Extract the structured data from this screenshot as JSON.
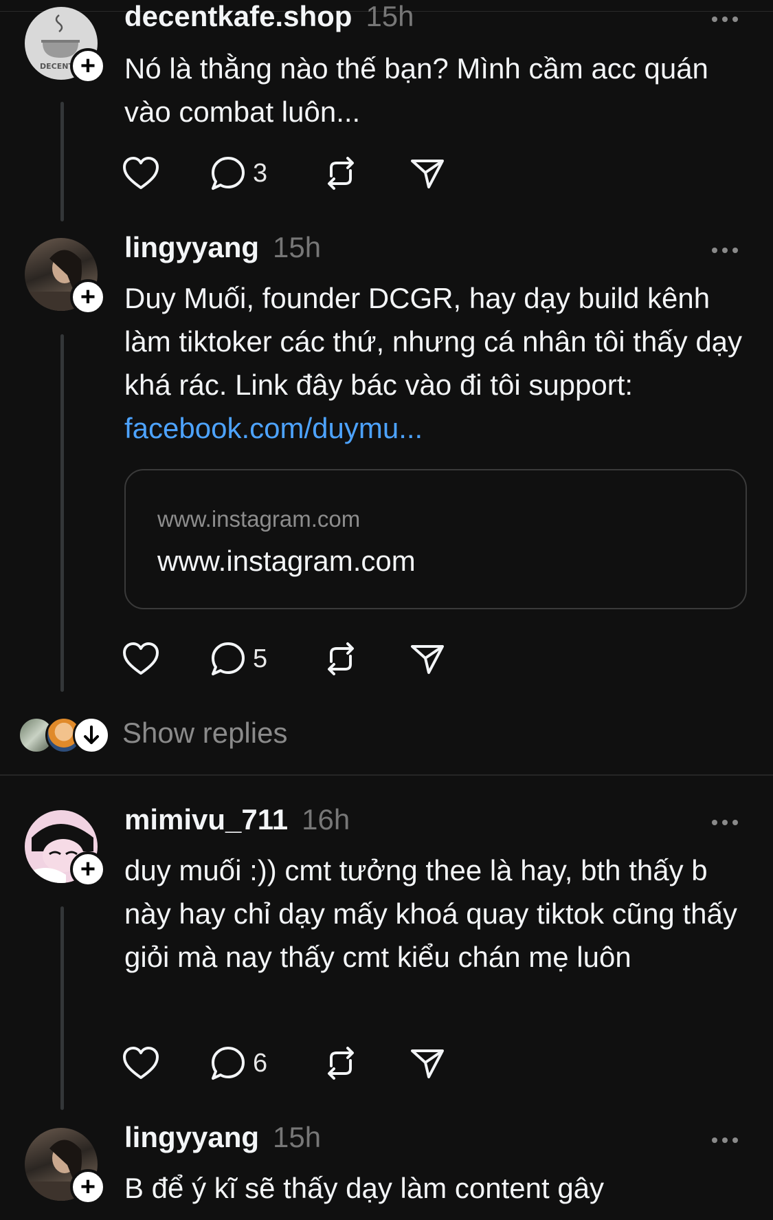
{
  "colors": {
    "background": "#101010",
    "text": "#f3f5f7",
    "muted": "#777777",
    "link": "#4da3ff",
    "thread_line": "#333638"
  },
  "posts": [
    {
      "username": "decentkafe.shop",
      "time": "15h",
      "avatar_text": "DECENT",
      "text": "Nó là thằng nào thế bạn? Mình cầm acc quán vào combat luôn...",
      "replies": "3"
    },
    {
      "username": "lingyyang",
      "time": "15h",
      "text": "Duy Muối, founder DCGR, hay dạy build kênh làm tiktoker các thứ, nhưng cá nhân tôi thấy dạy khá rác. Link đây bác vào đi tôi support: ",
      "link_text": "facebook.com/duymu...",
      "card_domain": "www.instagram.com",
      "card_title": "www.instagram.com",
      "replies": "5"
    },
    {
      "username": "mimivu_711",
      "time": "16h",
      "text": "duy muối :)) cmt tưởng thee là hay, bth thấy b này hay chỉ dạy mấy khoá quay tiktok cũng thấy giỏi mà nay thấy cmt kiểu chán mẹ luôn",
      "replies": "6"
    },
    {
      "username": "lingyyang",
      "time": "15h",
      "text": "B để ý kĩ sẽ thấy dạy làm content gây"
    }
  ],
  "show_replies_label": "Show replies",
  "icons": [
    "heart-icon",
    "comment-icon",
    "repost-icon",
    "share-icon",
    "more-icon",
    "plus-icon",
    "arrow-down-icon"
  ]
}
